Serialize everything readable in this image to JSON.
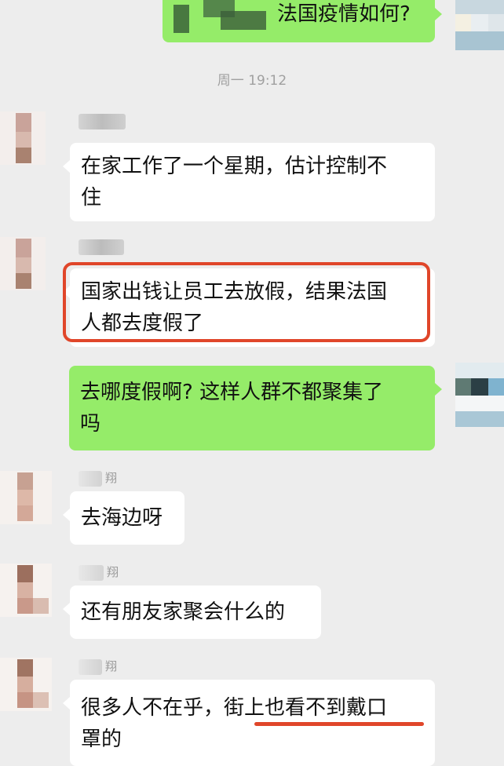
{
  "chat": {
    "timestamp": "周一 19:12",
    "messages": [
      {
        "side": "out",
        "lines": [
          "法国疫情如何?"
        ]
      },
      {
        "side": "in",
        "lines": [
          "在家工作了一个星期，估计控制不",
          "住"
        ]
      },
      {
        "side": "in",
        "lines": [
          "国家出钱让员工去放假，结果法国",
          "人都去度假了"
        ]
      },
      {
        "side": "out",
        "lines": [
          "去哪度假啊? 这样人群不都聚集了",
          "吗"
        ]
      },
      {
        "side": "in",
        "sender_suffix": "翔",
        "lines": [
          "去海边呀"
        ]
      },
      {
        "side": "in",
        "sender_suffix": "翔",
        "lines": [
          "还有朋友家聚会什么的"
        ]
      },
      {
        "side": "in",
        "sender_suffix": "翔",
        "lines": [
          "很多人不在乎，街上也看不到戴口",
          "罩的"
        ]
      }
    ]
  },
  "colors": {
    "incoming_bubble": "#ffffff",
    "outgoing_bubble": "#95ec69",
    "background": "#ededed",
    "annotation": "#e0462a"
  }
}
